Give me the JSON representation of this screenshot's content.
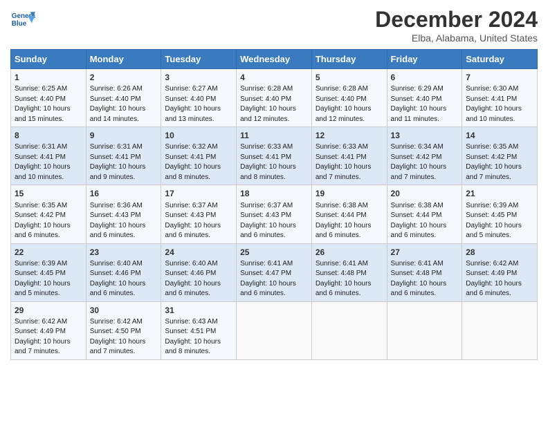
{
  "header": {
    "logo_line1": "General",
    "logo_line2": "Blue",
    "title": "December 2024",
    "subtitle": "Elba, Alabama, United States"
  },
  "days_of_week": [
    "Sunday",
    "Monday",
    "Tuesday",
    "Wednesday",
    "Thursday",
    "Friday",
    "Saturday"
  ],
  "weeks": [
    [
      {
        "day": "1",
        "sunrise": "6:25 AM",
        "sunset": "4:40 PM",
        "daylight": "10 hours and 15 minutes."
      },
      {
        "day": "2",
        "sunrise": "6:26 AM",
        "sunset": "4:40 PM",
        "daylight": "10 hours and 14 minutes."
      },
      {
        "day": "3",
        "sunrise": "6:27 AM",
        "sunset": "4:40 PM",
        "daylight": "10 hours and 13 minutes."
      },
      {
        "day": "4",
        "sunrise": "6:28 AM",
        "sunset": "4:40 PM",
        "daylight": "10 hours and 12 minutes."
      },
      {
        "day": "5",
        "sunrise": "6:28 AM",
        "sunset": "4:40 PM",
        "daylight": "10 hours and 12 minutes."
      },
      {
        "day": "6",
        "sunrise": "6:29 AM",
        "sunset": "4:40 PM",
        "daylight": "10 hours and 11 minutes."
      },
      {
        "day": "7",
        "sunrise": "6:30 AM",
        "sunset": "4:41 PM",
        "daylight": "10 hours and 10 minutes."
      }
    ],
    [
      {
        "day": "8",
        "sunrise": "6:31 AM",
        "sunset": "4:41 PM",
        "daylight": "10 hours and 10 minutes."
      },
      {
        "day": "9",
        "sunrise": "6:31 AM",
        "sunset": "4:41 PM",
        "daylight": "10 hours and 9 minutes."
      },
      {
        "day": "10",
        "sunrise": "6:32 AM",
        "sunset": "4:41 PM",
        "daylight": "10 hours and 8 minutes."
      },
      {
        "day": "11",
        "sunrise": "6:33 AM",
        "sunset": "4:41 PM",
        "daylight": "10 hours and 8 minutes."
      },
      {
        "day": "12",
        "sunrise": "6:33 AM",
        "sunset": "4:41 PM",
        "daylight": "10 hours and 7 minutes."
      },
      {
        "day": "13",
        "sunrise": "6:34 AM",
        "sunset": "4:42 PM",
        "daylight": "10 hours and 7 minutes."
      },
      {
        "day": "14",
        "sunrise": "6:35 AM",
        "sunset": "4:42 PM",
        "daylight": "10 hours and 7 minutes."
      }
    ],
    [
      {
        "day": "15",
        "sunrise": "6:35 AM",
        "sunset": "4:42 PM",
        "daylight": "10 hours and 6 minutes."
      },
      {
        "day": "16",
        "sunrise": "6:36 AM",
        "sunset": "4:43 PM",
        "daylight": "10 hours and 6 minutes."
      },
      {
        "day": "17",
        "sunrise": "6:37 AM",
        "sunset": "4:43 PM",
        "daylight": "10 hours and 6 minutes."
      },
      {
        "day": "18",
        "sunrise": "6:37 AM",
        "sunset": "4:43 PM",
        "daylight": "10 hours and 6 minutes."
      },
      {
        "day": "19",
        "sunrise": "6:38 AM",
        "sunset": "4:44 PM",
        "daylight": "10 hours and 6 minutes."
      },
      {
        "day": "20",
        "sunrise": "6:38 AM",
        "sunset": "4:44 PM",
        "daylight": "10 hours and 6 minutes."
      },
      {
        "day": "21",
        "sunrise": "6:39 AM",
        "sunset": "4:45 PM",
        "daylight": "10 hours and 5 minutes."
      }
    ],
    [
      {
        "day": "22",
        "sunrise": "6:39 AM",
        "sunset": "4:45 PM",
        "daylight": "10 hours and 5 minutes."
      },
      {
        "day": "23",
        "sunrise": "6:40 AM",
        "sunset": "4:46 PM",
        "daylight": "10 hours and 6 minutes."
      },
      {
        "day": "24",
        "sunrise": "6:40 AM",
        "sunset": "4:46 PM",
        "daylight": "10 hours and 6 minutes."
      },
      {
        "day": "25",
        "sunrise": "6:41 AM",
        "sunset": "4:47 PM",
        "daylight": "10 hours and 6 minutes."
      },
      {
        "day": "26",
        "sunrise": "6:41 AM",
        "sunset": "4:48 PM",
        "daylight": "10 hours and 6 minutes."
      },
      {
        "day": "27",
        "sunrise": "6:41 AM",
        "sunset": "4:48 PM",
        "daylight": "10 hours and 6 minutes."
      },
      {
        "day": "28",
        "sunrise": "6:42 AM",
        "sunset": "4:49 PM",
        "daylight": "10 hours and 6 minutes."
      }
    ],
    [
      {
        "day": "29",
        "sunrise": "6:42 AM",
        "sunset": "4:49 PM",
        "daylight": "10 hours and 7 minutes."
      },
      {
        "day": "30",
        "sunrise": "6:42 AM",
        "sunset": "4:50 PM",
        "daylight": "10 hours and 7 minutes."
      },
      {
        "day": "31",
        "sunrise": "6:43 AM",
        "sunset": "4:51 PM",
        "daylight": "10 hours and 8 minutes."
      },
      null,
      null,
      null,
      null
    ]
  ],
  "labels": {
    "sunrise": "Sunrise:",
    "sunset": "Sunset:",
    "daylight": "Daylight:"
  }
}
